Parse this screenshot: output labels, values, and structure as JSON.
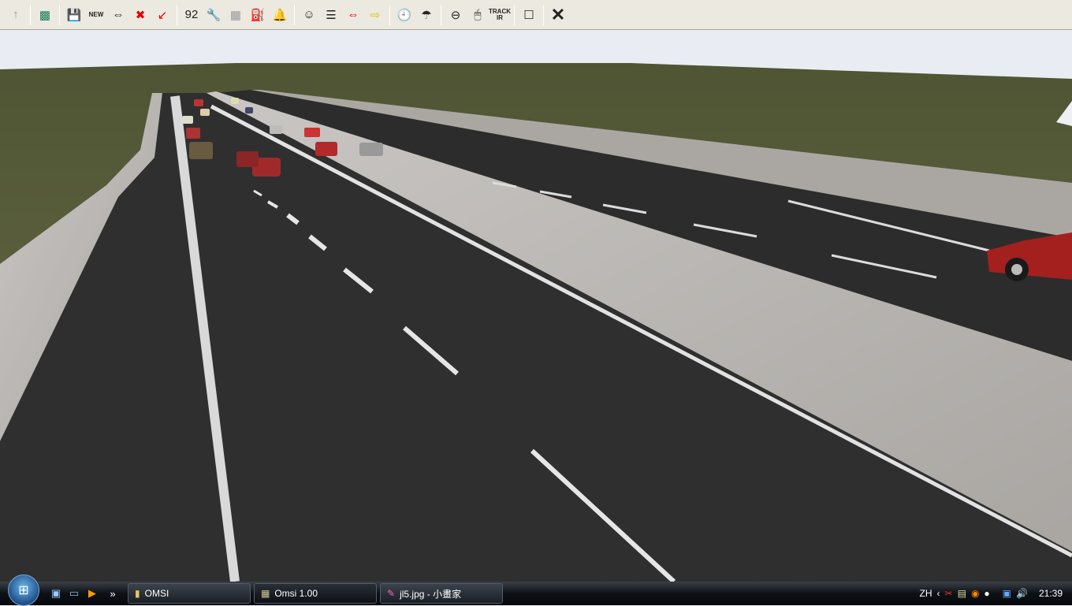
{
  "toolbar": {
    "buttons": [
      {
        "name": "up-arrow",
        "glyph": "↑"
      },
      {
        "name": "map",
        "glyph": "▩"
      },
      {
        "name": "save",
        "glyph": "💾"
      },
      {
        "name": "new-bus",
        "text": "NEW"
      },
      {
        "name": "change-bus",
        "glyph": "⇔"
      },
      {
        "name": "delete-bus",
        "glyph": "✖"
      },
      {
        "name": "place-vehicle",
        "glyph": "↙"
      },
      {
        "name": "route-number",
        "glyph": "92"
      },
      {
        "name": "repair",
        "glyph": "🔧"
      },
      {
        "name": "ticket-printer",
        "glyph": "▦"
      },
      {
        "name": "fuel",
        "glyph": "⛽"
      },
      {
        "name": "bell",
        "glyph": "🔔"
      },
      {
        "name": "driver",
        "glyph": "☺"
      },
      {
        "name": "timetable",
        "glyph": "☰"
      },
      {
        "name": "pc-switch",
        "glyph": "⇔"
      },
      {
        "name": "help-next",
        "glyph": "⇨"
      },
      {
        "name": "clock",
        "glyph": "🕘"
      },
      {
        "name": "weather",
        "glyph": "☂"
      },
      {
        "name": "steering-wheel",
        "glyph": "⊖"
      },
      {
        "name": "mouse",
        "glyph": "🖱"
      },
      {
        "name": "trackir",
        "text": "TRACK IR"
      },
      {
        "name": "checkbox-options",
        "glyph": "☐"
      },
      {
        "name": "close",
        "glyph": "✕"
      }
    ]
  },
  "taskbar": {
    "tasks": [
      "OMSI",
      "Omsi 1.00",
      "jl5.jpg - 小畫家"
    ],
    "language": "ZH",
    "clock": "21:39",
    "more": "»"
  },
  "colors": {
    "asphalt": "#2f2f30",
    "concrete": "#b9b6b2",
    "grass": "#5c6140",
    "sky": "#e9edf3"
  }
}
